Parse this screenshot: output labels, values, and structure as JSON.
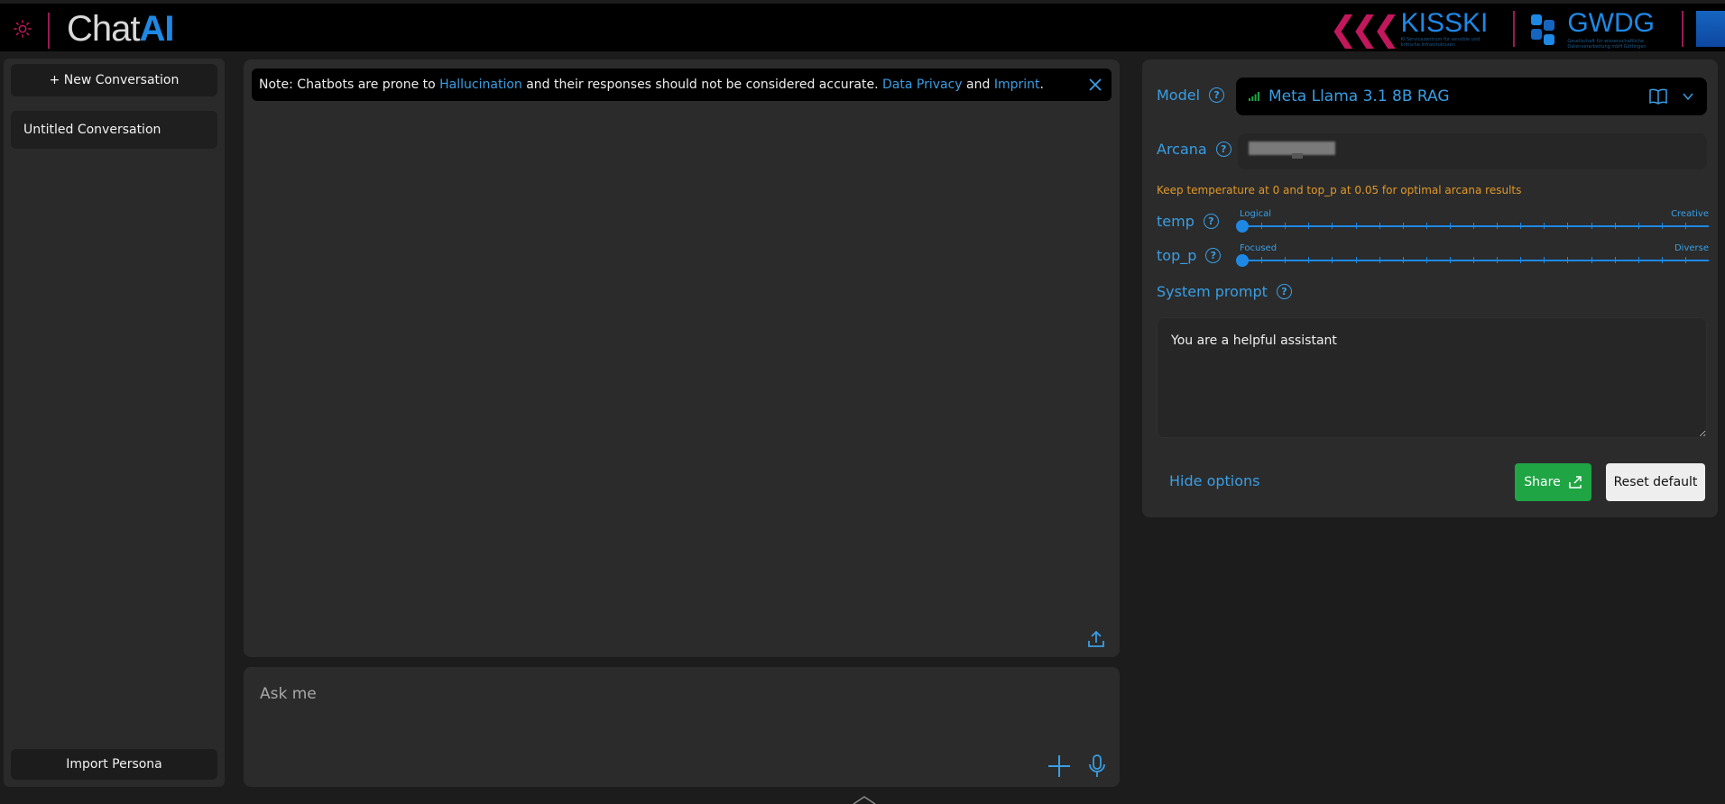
{
  "header": {
    "logo_chat": "Chat",
    "logo_ai": "AI",
    "kisski_name": "KISSKI",
    "kisski_sub": "KI Servicezentrum für sensible und kritische Infrastrukturen",
    "gwdg_name": "GWDG",
    "gwdg_sub": "Gesellschaft für wissenschaftliche Datenverarbeitung mbH Göttingen"
  },
  "sidebar": {
    "new_conversation": "+ New Conversation",
    "conversations": [
      "Untitled Conversation"
    ],
    "import_persona": "Import Persona"
  },
  "note": {
    "prefix": "Note: Chatbots are prone to ",
    "hallucination": "Hallucination",
    "middle": " and their responses should not be considered accurate. ",
    "data_privacy": "Data Privacy",
    "and": " and ",
    "imprint": "Imprint",
    "suffix": "."
  },
  "input": {
    "placeholder": "Ask me"
  },
  "options": {
    "model_label": "Model",
    "model_value": "Meta Llama 3.1 8B RAG",
    "arcana_label": "Arcana",
    "warning": "Keep temperature at 0 and top_p at 0.05 for optimal arcana results",
    "temp_label": "temp",
    "temp_min_label": "Logical",
    "temp_max_label": "Creative",
    "temp_value": 0,
    "top_p_label": "top_p",
    "top_p_min_label": "Focused",
    "top_p_max_label": "Diverse",
    "top_p_value": 0,
    "system_prompt_label": "System prompt",
    "system_prompt_value": "You are a helpful assistant",
    "hide_options": "Hide options",
    "share": "Share",
    "reset_default": "Reset default"
  },
  "colors": {
    "accent": "#1e88e5",
    "link": "#3a9ee4",
    "share_green": "#1fa544",
    "warning": "#e0982a",
    "brand_magenta": "#c2185b"
  },
  "icons": {
    "theme": "sun-icon",
    "close": "close-icon",
    "upload": "upload-icon",
    "plus": "plus-icon",
    "mic": "microphone-icon",
    "help": "question-circle-icon",
    "model_info": "book-icon",
    "dropdown": "chevron-down-icon",
    "share": "share-icon"
  }
}
